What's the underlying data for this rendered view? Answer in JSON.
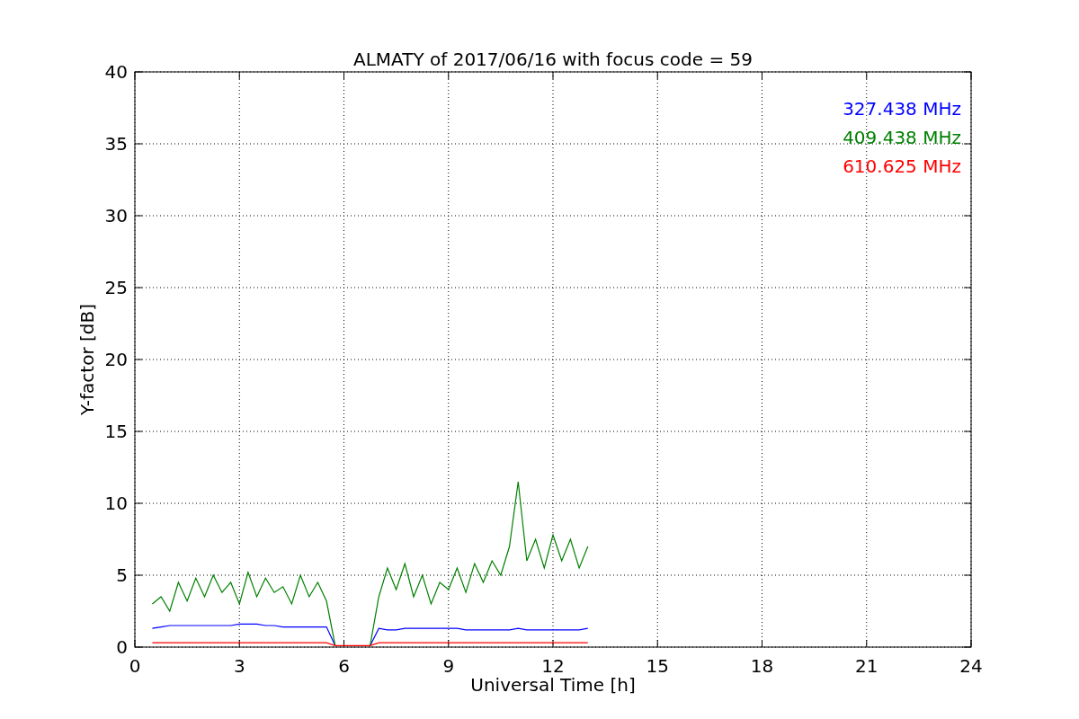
{
  "figure": {
    "chart_data": {
      "type": "line",
      "title": "ALMATY of 2017/06/16 with focus code = 59",
      "xlabel": "Universal Time [h]",
      "ylabel": "Y-factor [dB]",
      "x": [
        0.5,
        0.75,
        1.0,
        1.25,
        1.5,
        1.75,
        2.0,
        2.25,
        2.5,
        2.75,
        3.0,
        3.25,
        3.5,
        3.75,
        4.0,
        4.25,
        4.5,
        4.75,
        5.0,
        5.25,
        5.5,
        5.75,
        6.0,
        6.25,
        6.5,
        6.75,
        7.0,
        7.25,
        7.5,
        7.75,
        8.0,
        8.25,
        8.5,
        8.75,
        9.0,
        9.25,
        9.5,
        9.75,
        10.0,
        10.25,
        10.5,
        10.75,
        11.0,
        11.25,
        11.5,
        11.75,
        12.0,
        12.25,
        12.5,
        12.75,
        13.0
      ],
      "series": [
        {
          "name": "327.438 MHz",
          "color": "#0000ff",
          "values": [
            1.3,
            1.4,
            1.5,
            1.5,
            1.5,
            1.5,
            1.5,
            1.5,
            1.5,
            1.5,
            1.6,
            1.6,
            1.6,
            1.5,
            1.5,
            1.4,
            1.4,
            1.4,
            1.4,
            1.4,
            1.4,
            0.1,
            null,
            null,
            null,
            0.1,
            1.3,
            1.2,
            1.2,
            1.3,
            1.3,
            1.3,
            1.3,
            1.3,
            1.3,
            1.3,
            1.2,
            1.2,
            1.2,
            1.2,
            1.2,
            1.2,
            1.3,
            1.2,
            1.2,
            1.2,
            1.2,
            1.2,
            1.2,
            1.2,
            1.3
          ]
        },
        {
          "name": "409.438 MHz",
          "color": "#008000",
          "values": [
            3.0,
            3.5,
            2.5,
            4.5,
            3.2,
            4.8,
            3.5,
            5.0,
            3.8,
            4.5,
            3.0,
            5.2,
            3.5,
            4.8,
            3.8,
            4.2,
            3.0,
            5.0,
            3.5,
            4.5,
            3.2,
            0.1,
            null,
            null,
            null,
            0.1,
            3.5,
            5.5,
            4.0,
            5.8,
            3.5,
            5.0,
            3.0,
            4.5,
            4.0,
            5.5,
            3.8,
            5.8,
            4.5,
            6.0,
            5.0,
            7.0,
            11.5,
            6.0,
            7.5,
            5.5,
            7.8,
            6.0,
            7.5,
            5.5,
            7.0
          ]
        },
        {
          "name": "610.625 MHz",
          "color": "#ff0000",
          "values": [
            0.3,
            0.3,
            0.3,
            0.3,
            0.3,
            0.3,
            0.3,
            0.3,
            0.3,
            0.3,
            0.3,
            0.3,
            0.3,
            0.3,
            0.3,
            0.3,
            0.3,
            0.3,
            0.3,
            0.3,
            0.3,
            0.1,
            0.1,
            0.1,
            0.1,
            0.1,
            0.3,
            0.3,
            0.3,
            0.3,
            0.3,
            0.3,
            0.3,
            0.3,
            0.3,
            0.3,
            0.3,
            0.3,
            0.3,
            0.3,
            0.3,
            0.3,
            0.3,
            0.3,
            0.3,
            0.3,
            0.3,
            0.3,
            0.3,
            0.3,
            0.3
          ]
        }
      ],
      "grid": true,
      "xlim": [
        0,
        24
      ],
      "ylim": [
        0,
        40
      ],
      "xticks": [
        0,
        3,
        6,
        9,
        12,
        15,
        18,
        21,
        24
      ],
      "yticks": [
        0,
        5,
        10,
        15,
        20,
        25,
        30,
        35,
        40
      ]
    }
  }
}
